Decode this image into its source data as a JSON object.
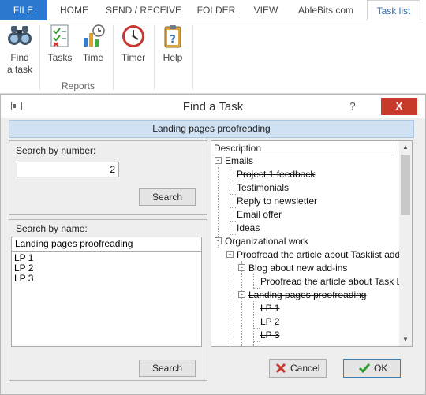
{
  "ribbon_tabs": [
    "FILE",
    "HOME",
    "SEND / RECEIVE",
    "FOLDER",
    "VIEW",
    "AbleBits.com",
    "Task list"
  ],
  "ribbon": {
    "find_label_1": "Find",
    "find_label_2": "a task",
    "tasks_label": "Tasks",
    "time_label": "Time",
    "timer_label": "Timer",
    "help_label": "Help",
    "reports_group": "Reports"
  },
  "dialog": {
    "title": "Find a Task",
    "help_glyph": "?",
    "close_glyph": "X",
    "selected_task": "Landing pages proofreading",
    "by_number_label": "Search by number:",
    "number_value": "2",
    "search_button": "Search",
    "by_name_label": "Search by name:",
    "name_value": "Landing pages proofreading",
    "name_results": [
      "LP 1",
      "LP 2",
      "LP 3"
    ],
    "tree_header": "Description",
    "tree": [
      {
        "text": "Emails",
        "level": 0,
        "expander": "-",
        "done": false
      },
      {
        "text": "Project 1 feedback",
        "level": 1,
        "done": true
      },
      {
        "text": "Testimonials",
        "level": 1,
        "done": false
      },
      {
        "text": "Reply to newsletter",
        "level": 1,
        "done": false
      },
      {
        "text": "Email offer",
        "level": 1,
        "done": false
      },
      {
        "text": "Ideas",
        "level": 1,
        "done": false
      },
      {
        "text": "Organizational work",
        "level": 0,
        "expander": "-",
        "done": false
      },
      {
        "text": "Proofread the article about Tasklist add-in",
        "level": 1,
        "expander": "-",
        "done": false
      },
      {
        "text": "Blog about new add-ins",
        "level": 2,
        "expander": "-",
        "done": false
      },
      {
        "text": "Proofread the article about Task List",
        "level": 3,
        "done": false
      },
      {
        "text": "Landing pages proofreading",
        "level": 2,
        "expander": "-",
        "done": true
      },
      {
        "text": "LP 1",
        "level": 3,
        "done": true
      },
      {
        "text": "LP 2",
        "level": 3,
        "done": true
      },
      {
        "text": "LP 3",
        "level": 3,
        "done": true
      }
    ],
    "cancel_button": "Cancel",
    "ok_button": "OK"
  },
  "colors": {
    "file_tab": "#2b79d0",
    "banner": "#cfe1f2",
    "close_button": "#c7392b",
    "ok_check": "#2e9a2e",
    "cancel_x": "#c0392b"
  }
}
